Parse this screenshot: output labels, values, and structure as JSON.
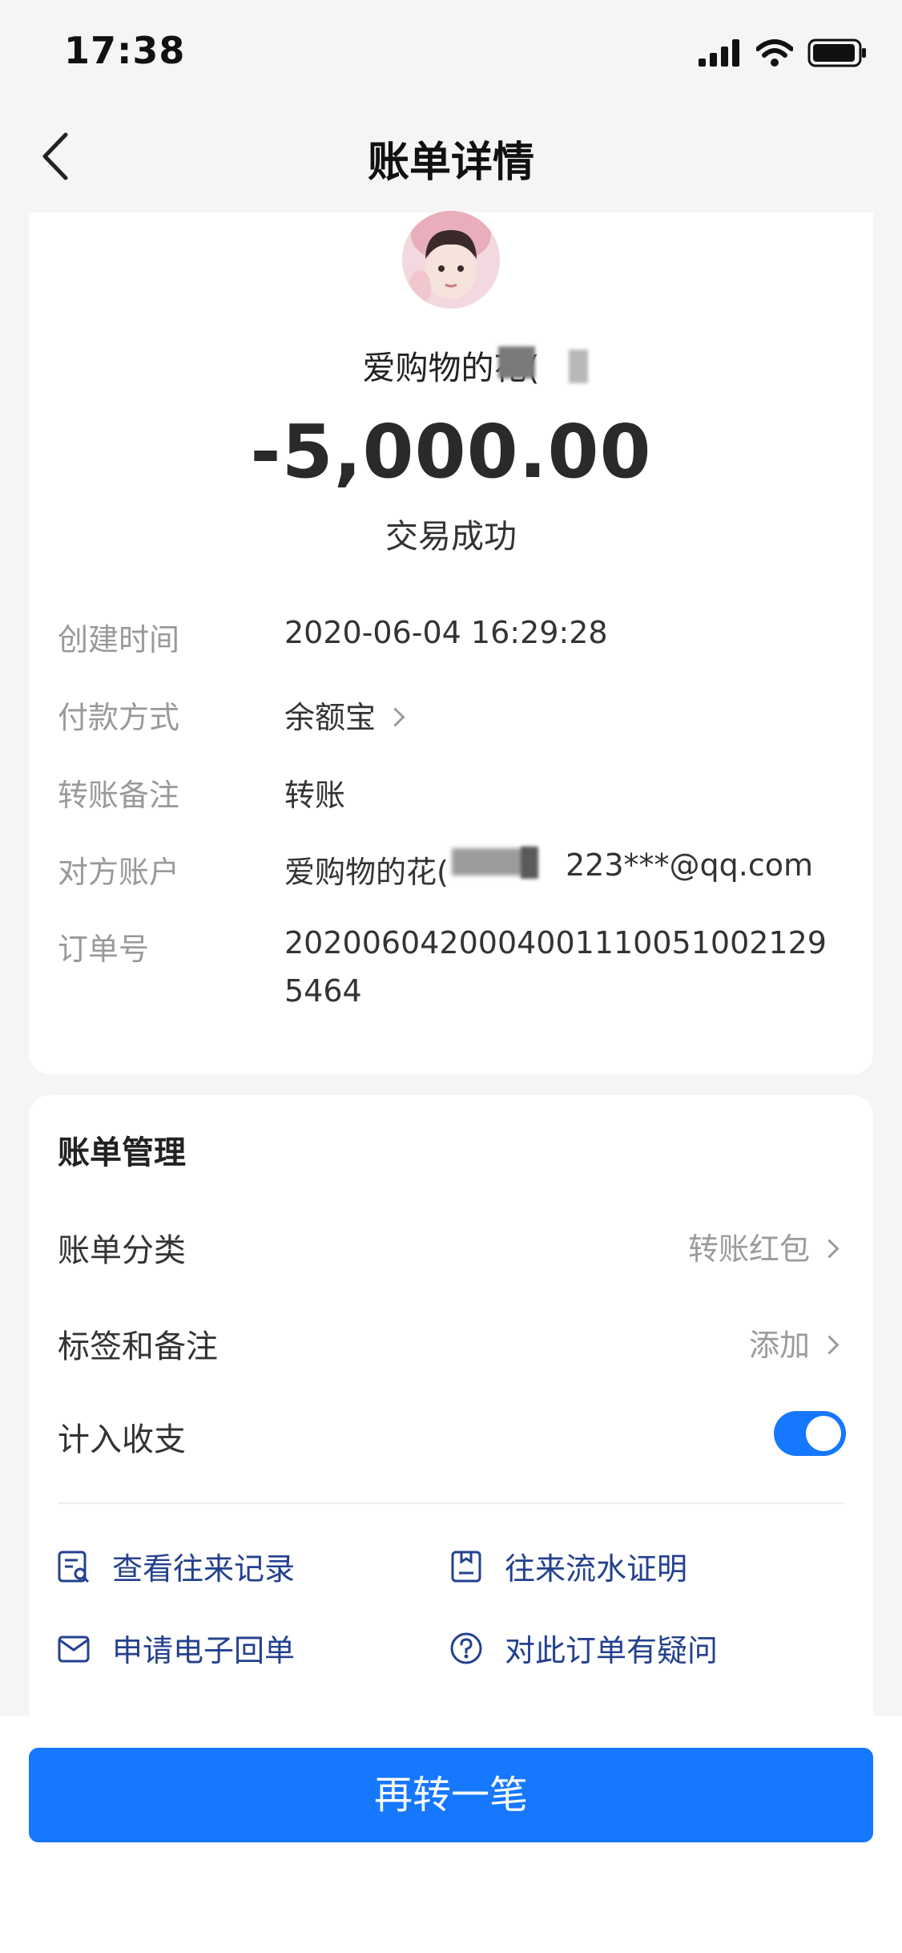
{
  "status_bar": {
    "time": "17:38",
    "icons": [
      "signal-icon",
      "wifi-icon",
      "battery-icon"
    ]
  },
  "header": {
    "title": "账单详情",
    "back_icon": "chevron-left-icon"
  },
  "transaction": {
    "payee_name": "爱购物的花(",
    "amount": "-5,000.00",
    "status": "交易成功"
  },
  "details": [
    {
      "label": "创建时间",
      "value": "2020-06-04 16:29:28"
    },
    {
      "label": "付款方式",
      "value": "余额宝"
    },
    {
      "label": "转账备注",
      "value": "转账"
    },
    {
      "label": "对方账户",
      "value_prefix": "爱购物的花(",
      "value_suffix": "223***@qq.com"
    },
    {
      "label": "订单号",
      "value": "20200604200040011100510021295464"
    }
  ],
  "management": {
    "title": "账单管理",
    "category_label": "账单分类",
    "category_value": "转账红包",
    "tags_label": "标签和备注",
    "tags_value": "添加",
    "include_label": "计入收支",
    "include_enabled": true
  },
  "links": [
    {
      "label": "查看往来记录",
      "icon": "record-search-icon"
    },
    {
      "label": "往来流水证明",
      "icon": "document-icon"
    },
    {
      "label": "申请电子回单",
      "icon": "mail-icon"
    },
    {
      "label": "对此订单有疑问",
      "icon": "question-icon"
    }
  ],
  "action_button": "再转一笔",
  "colors": {
    "accent": "#1677ff",
    "link": "#24418f",
    "background": "#f5f5f5"
  }
}
